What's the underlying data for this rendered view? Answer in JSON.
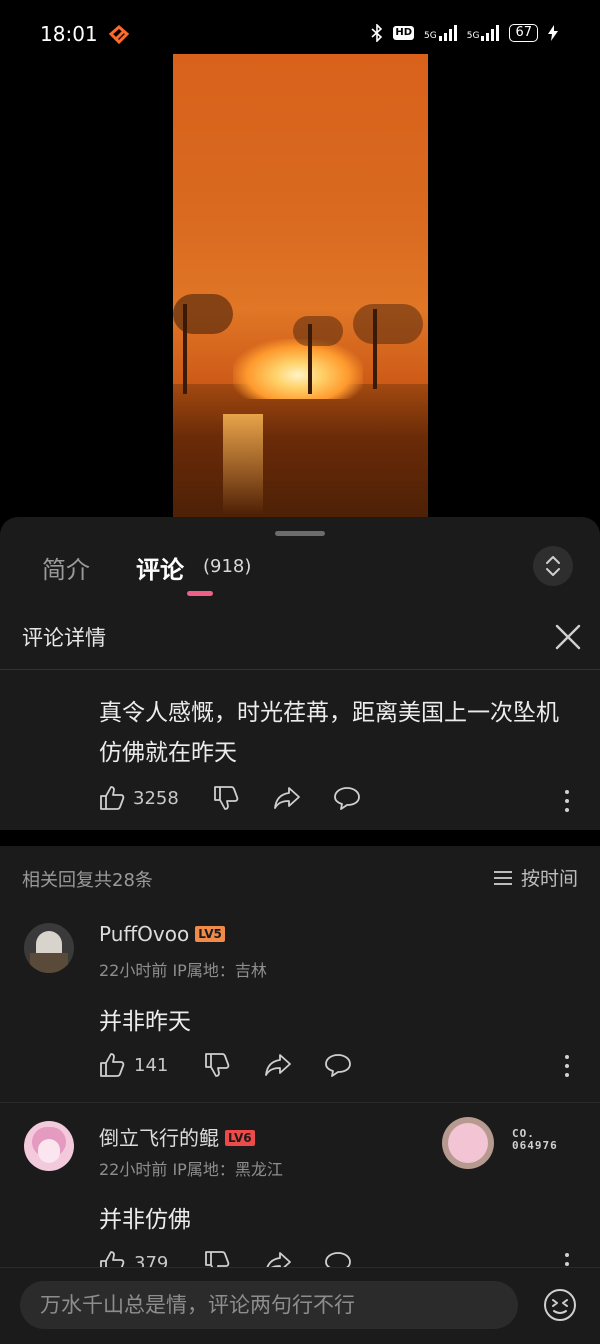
{
  "status_bar": {
    "time": "18:01",
    "battery": "67",
    "network_1": "5G",
    "network_2": "5G",
    "hd_label": "HD"
  },
  "video": {
    "icon": "video-frame-fire-scene"
  },
  "tabs": {
    "intro": "简介",
    "comments": "评论",
    "comments_count": "(918)"
  },
  "detail": {
    "title": "评论详情"
  },
  "main_comment": {
    "text": "真令人感慨，时光荏苒，距离美国上一次坠机仿佛就在昨天",
    "likes": "3258"
  },
  "replies_header": {
    "count_label": "相关回复共28条",
    "sort_label": "按时间"
  },
  "replies": [
    {
      "username": "PuffOvoo",
      "level": "LV5",
      "level_color": "#f08b4a",
      "meta": "22小时前 IP属地：吉林",
      "text": "并非昨天",
      "likes": "141"
    },
    {
      "username": "倒立飞行的鲲",
      "level": "LV6",
      "level_color": "#ee4a4a",
      "meta": "22小时前 IP属地：黑龙江",
      "text": "并非仿佛",
      "likes": "379",
      "fan_no_line1": "CO.",
      "fan_no_line2": "064976"
    }
  ],
  "input": {
    "placeholder": "万水千山总是情，评论两句行不行"
  },
  "colors": {
    "accent_pink": "#ef5f88",
    "sheet_bg": "#1b1b1b"
  }
}
